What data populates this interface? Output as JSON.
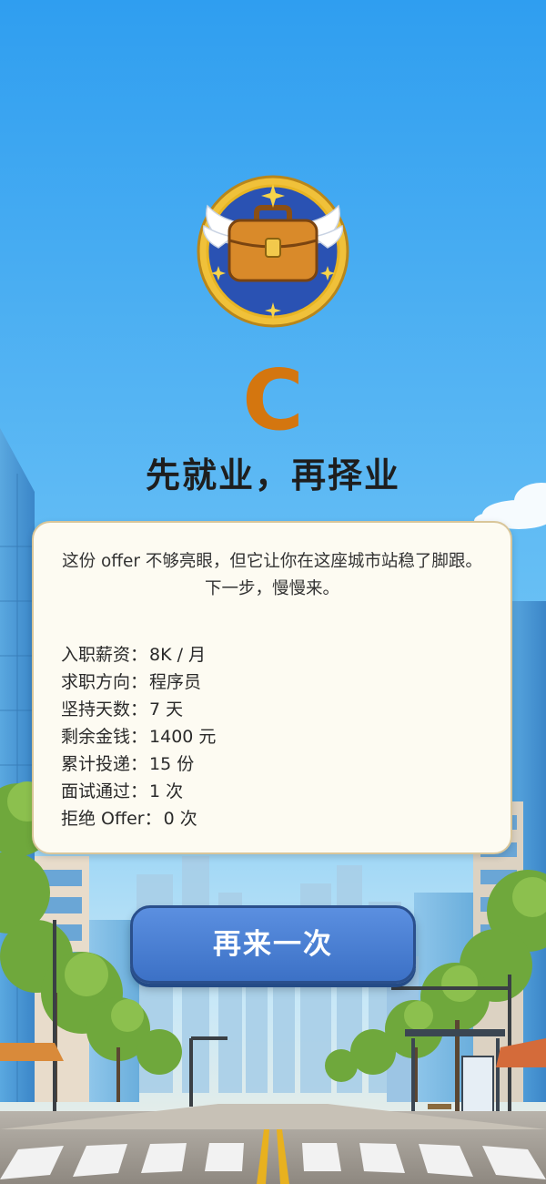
{
  "result": {
    "grade": "C",
    "title": "先就业，再择业",
    "description": "这份 offer 不够亮眼，但它让你在这座城市站稳了脚跟。下一步，慢慢来。",
    "stats": [
      {
        "label": "入职薪资：",
        "value": "8K / 月"
      },
      {
        "label": "求职方向：",
        "value": "程序员"
      },
      {
        "label": "坚持天数：",
        "value": "7 天"
      },
      {
        "label": "剩余金钱：",
        "value": "1400 元"
      },
      {
        "label": "累计投递：",
        "value": "15 份"
      },
      {
        "label": "面试通过：",
        "value": "1 次"
      },
      {
        "label": "拒绝 Offer：",
        "value": "0 次"
      }
    ]
  },
  "actions": {
    "retry_label": "再来一次"
  },
  "badge": {
    "icon": "winged-briefcase-icon"
  },
  "colors": {
    "sky_top": "#2f9ef0",
    "grade": "#d4760f",
    "button": "#4a80d4",
    "card_bg": "#fdfbf2"
  }
}
